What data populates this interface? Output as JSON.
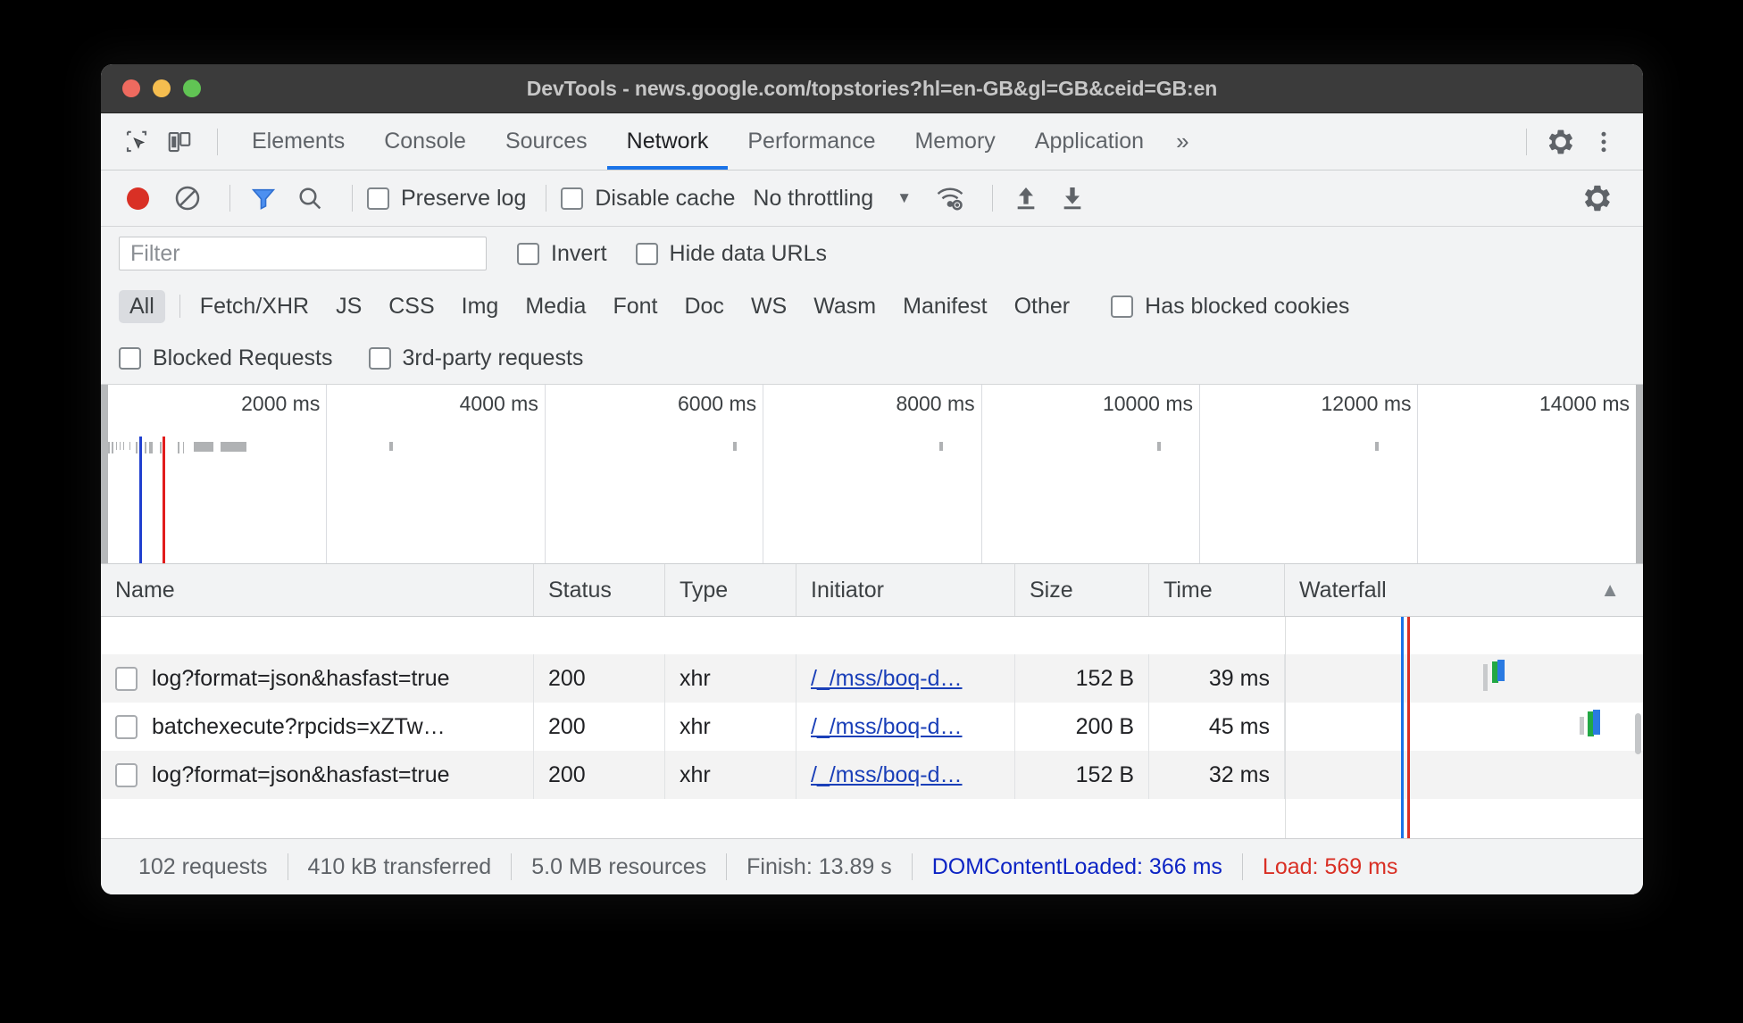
{
  "window": {
    "title": "DevTools - news.google.com/topstories?hl=en-GB&gl=GB&ceid=GB:en",
    "traffic_lights": [
      "close",
      "minimize",
      "maximize"
    ]
  },
  "tabstrip": {
    "inspect_icon": "inspect-element-icon",
    "device_icon": "device-toolbar-icon",
    "tabs": [
      {
        "label": "Elements",
        "active": false
      },
      {
        "label": "Console",
        "active": false
      },
      {
        "label": "Sources",
        "active": false
      },
      {
        "label": "Network",
        "active": true
      },
      {
        "label": "Performance",
        "active": false
      },
      {
        "label": "Memory",
        "active": false
      },
      {
        "label": "Application",
        "active": false
      }
    ],
    "more_label": "»",
    "settings_icon": "gear-icon",
    "menu_icon": "kebab-menu-icon"
  },
  "network_toolbar": {
    "record_icon": "record-button-icon",
    "clear_icon": "clear-icon",
    "filter_icon": "filter-funnel-icon",
    "search_icon": "search-icon",
    "preserve_log_label": "Preserve log",
    "preserve_log_checked": false,
    "disable_cache_label": "Disable cache",
    "disable_cache_checked": false,
    "throttling_value": "No throttling",
    "throttling_caret": "▼",
    "wifi_icon": "network-conditions-icon",
    "import_icon": "upload-har-icon",
    "export_icon": "download-har-icon",
    "settings_icon": "gear-icon"
  },
  "filter_bar": {
    "placeholder": "Filter",
    "value": "",
    "invert_label": "Invert",
    "invert_checked": false,
    "hide_data_urls_label": "Hide data URLs",
    "hide_data_urls_checked": false
  },
  "type_filters": {
    "all_label": "All",
    "items": [
      "Fetch/XHR",
      "JS",
      "CSS",
      "Img",
      "Media",
      "Font",
      "Doc",
      "WS",
      "Wasm",
      "Manifest",
      "Other"
    ],
    "selected": "All",
    "has_blocked_cookies_label": "Has blocked cookies",
    "has_blocked_cookies_checked": false
  },
  "extra_filters": {
    "blocked_requests_label": "Blocked Requests",
    "blocked_requests_checked": false,
    "third_party_label": "3rd-party requests",
    "third_party_checked": false
  },
  "overview": {
    "ticks": [
      "2000 ms",
      "4000 ms",
      "6000 ms",
      "8000 ms",
      "10000 ms",
      "12000 ms",
      "14000 ms"
    ],
    "dcl_color": "#1f3fcf",
    "load_color": "#e11d1d"
  },
  "table": {
    "columns": [
      "Name",
      "Status",
      "Type",
      "Initiator",
      "Size",
      "Time",
      "Waterfall"
    ],
    "sort_column": "Waterfall",
    "sort_direction": "▲",
    "rows": [
      {
        "name": "log?format=json&hasfast=true",
        "status": "200",
        "type": "xhr",
        "initiator": "/_/mss/boq-d…",
        "size": "152 B",
        "time": "39 ms"
      },
      {
        "name": "batchexecute?rpcids=xZTw…",
        "status": "200",
        "type": "xhr",
        "initiator": "/_/mss/boq-d…",
        "size": "200 B",
        "time": "45 ms"
      },
      {
        "name": "log?format=json&hasfast=true",
        "status": "200",
        "type": "xhr",
        "initiator": "/_/mss/boq-d…",
        "size": "152 B",
        "time": "32 ms"
      }
    ]
  },
  "status_bar": {
    "requests": "102 requests",
    "transferred": "410 kB transferred",
    "resources": "5.0 MB resources",
    "finish": "Finish: 13.89 s",
    "dom_content_loaded": "DOMContentLoaded: 366 ms",
    "load": "Load: 569 ms",
    "dcl_color": "#0d24c4",
    "load_color": "#d93025"
  }
}
